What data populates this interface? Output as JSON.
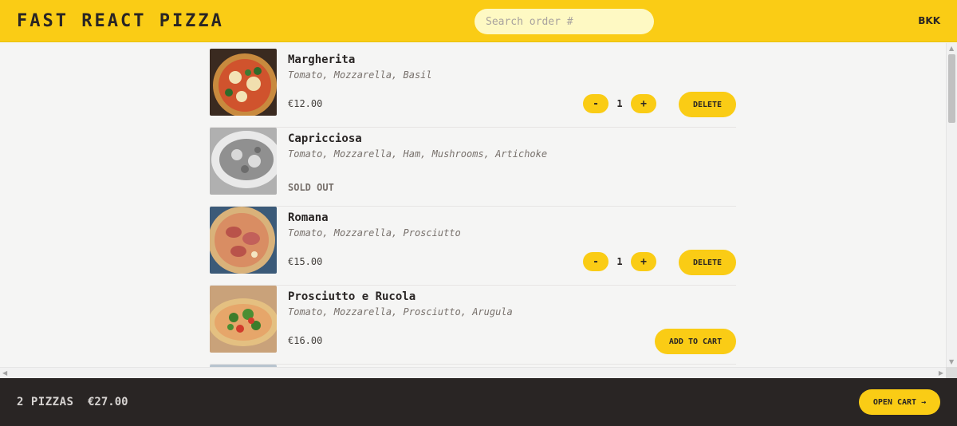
{
  "header": {
    "logo": "FAST REACT PIZZA",
    "search_placeholder": "Search order #",
    "user": "BKK"
  },
  "menu": {
    "items": [
      {
        "name": "Margherita",
        "ingredients": "Tomato, Mozzarella, Basil",
        "price": "€12.00",
        "state": "in-cart",
        "quantity": "1",
        "dec_label": "-",
        "inc_label": "+",
        "delete_label": "DELETE"
      },
      {
        "name": "Capricciosa",
        "ingredients": "Tomato, Mozzarella, Ham, Mushrooms, Artichoke",
        "sold_out_label": "SOLD OUT",
        "state": "sold-out"
      },
      {
        "name": "Romana",
        "ingredients": "Tomato, Mozzarella, Prosciutto",
        "price": "€15.00",
        "state": "in-cart",
        "quantity": "1",
        "dec_label": "-",
        "inc_label": "+",
        "delete_label": "DELETE"
      },
      {
        "name": "Prosciutto e Rucola",
        "ingredients": "Tomato, Mozzarella, Prosciutto, Arugula",
        "price": "€16.00",
        "state": "available",
        "add_label": "ADD TO CART"
      }
    ]
  },
  "footer": {
    "count": "2 PIZZAS",
    "total": "€27.00",
    "open_cart_label": "OPEN CART →"
  },
  "colors": {
    "accent": "#facc15",
    "footer_bg": "#292524",
    "page_bg": "#f5f5f4"
  }
}
